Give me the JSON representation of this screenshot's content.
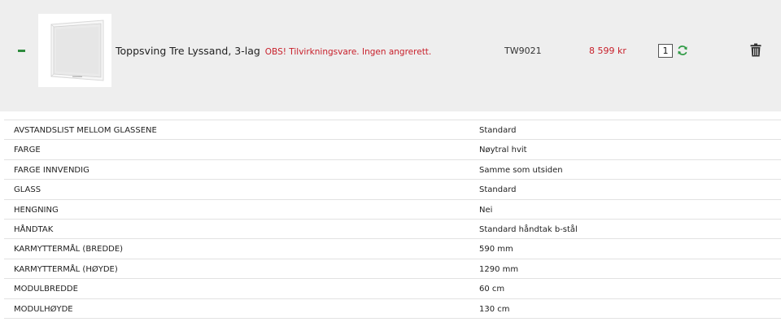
{
  "item": {
    "name": "Toppsving Tre Lyssand, 3-lag",
    "note": "OBS! Tilvirkningsvare. Ingen angrerett.",
    "sku": "TW9021",
    "price": "8 599 kr",
    "quantity": "1",
    "collapse_icon": "minus-icon",
    "refresh_icon": "refresh-icon",
    "delete_icon": "trash-icon",
    "colors": {
      "accent_green": "#2e8b3e",
      "price_red": "#c8202b",
      "row_bg": "#eeeeee"
    }
  },
  "specs": [
    {
      "label": "AVSTANDSLIST MELLOM GLASSENE",
      "value": "Standard"
    },
    {
      "label": "FARGE",
      "value": "Nøytral hvit"
    },
    {
      "label": "FARGE INNVENDIG",
      "value": "Samme som utsiden"
    },
    {
      "label": "GLASS",
      "value": "Standard"
    },
    {
      "label": "HENGNING",
      "value": "Nei"
    },
    {
      "label": "HÅNDTAK",
      "value": "Standard håndtak b-stål"
    },
    {
      "label": "KARMYTTERMÅL (BREDDE)",
      "value": "590 mm"
    },
    {
      "label": "KARMYTTERMÅL (HØYDE)",
      "value": "1290 mm"
    },
    {
      "label": "MODULBREDDE",
      "value": "60 cm"
    },
    {
      "label": "MODULHØYDE",
      "value": "130 cm"
    }
  ]
}
